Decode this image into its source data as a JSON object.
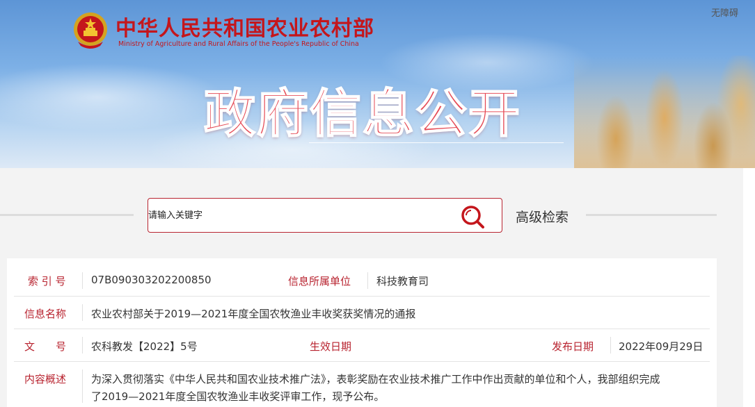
{
  "header": {
    "org_name_cn": "中华人民共和国农业农村部",
    "org_name_en": "Ministry of Agriculture and Rural Affairs of the People's Republic of China",
    "accessibility": "无障碍",
    "banner_title": "政府信息公开"
  },
  "search": {
    "placeholder": "请输入关键字",
    "advanced_label": "高级检索"
  },
  "info": {
    "index_label": "索 引 号",
    "index_value": "07B090303202200850",
    "dept_label": "信息所属单位",
    "dept_value": "科技教育司",
    "name_label": "信息名称",
    "name_value": "农业农村部关于2019—2021年度全国农牧渔业丰收奖获奖情况的通报",
    "doc_label": "文　　号",
    "doc_value": "农科教发【2022】5号",
    "effective_label": "生效日期",
    "effective_value": "",
    "publish_label": "发布日期",
    "publish_value": "2022年09月29日",
    "summary_label": "内容概述",
    "summary_line1": "为深入贯彻落实《中华人民共和国农业技术推广法》，表彰奖励在农业技术推广工作中作出贡献的单位和个人，我部组织完成",
    "summary_line2": "了2019—2021年度全国农牧渔业丰收奖评审工作，现予公布。"
  },
  "colors": {
    "brand_red": "#c4161c",
    "label_red": "#b8232f",
    "banner_title": "#e54a55"
  }
}
